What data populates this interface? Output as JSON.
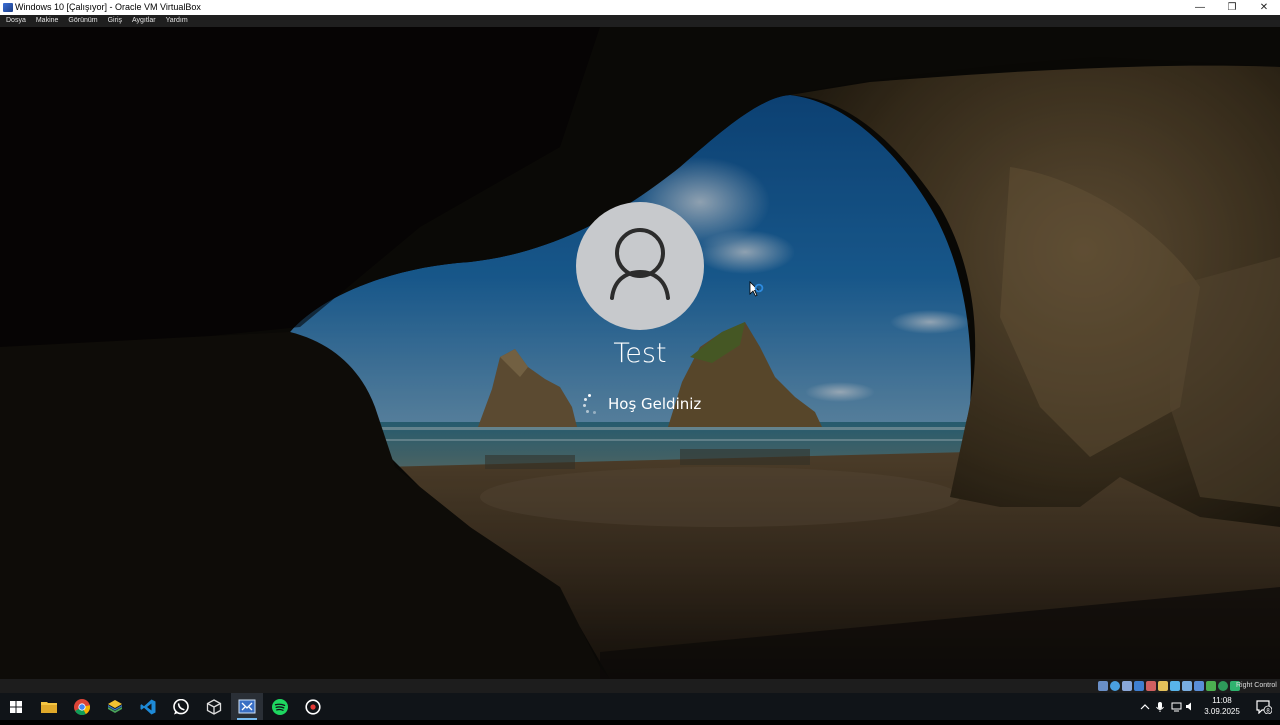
{
  "window": {
    "title": "Windows 10 [Çalışıyor] - Oracle VM VirtualBox",
    "controls": {
      "minimize": "—",
      "restore": "❐",
      "close": "✕"
    }
  },
  "menu": [
    "Dosya",
    "Makine",
    "Görünüm",
    "Giriş",
    "Aygıtlar",
    "Yardım"
  ],
  "lock_screen": {
    "user_name": "Test",
    "status_text": "Hoş Geldiniz",
    "avatar_icon": "user-silhouette-icon",
    "busy_indicator": "spinner-icon"
  },
  "vbox_status": {
    "host_key": "Right Control",
    "icons": [
      "hard-disk-icon",
      "optical-drive-icon",
      "audio-icon",
      "network-icon",
      "usb-icon",
      "shared-folders-icon",
      "display-icon",
      "video-capture-icon",
      "guest-additions-icon",
      "cpu-icon",
      "mouse-integration-icon",
      "keyboard-icon"
    ]
  },
  "taskbar": {
    "apps": [
      {
        "name": "start",
        "icon": "windows-start-icon",
        "active": false
      },
      {
        "name": "file-explorer",
        "icon": "folder-icon",
        "active": false
      },
      {
        "name": "chrome",
        "icon": "chrome-icon",
        "active": false
      },
      {
        "name": "layers-app",
        "icon": "layers-icon",
        "active": false
      },
      {
        "name": "vscode",
        "icon": "vscode-icon",
        "active": false
      },
      {
        "name": "whatsapp",
        "icon": "whatsapp-icon",
        "active": false
      },
      {
        "name": "virtualbox-manager",
        "icon": "cube-icon",
        "active": false
      },
      {
        "name": "virtualbox-vm",
        "icon": "virtualbox-vm-icon",
        "active": true
      },
      {
        "name": "spotify",
        "icon": "spotify-icon",
        "active": false
      },
      {
        "name": "recorder",
        "icon": "record-icon",
        "active": false
      }
    ],
    "clock_time": "11:08",
    "clock_date": "3.09.2025",
    "notification_count": "8",
    "tray_icons": [
      "chevron-up-icon",
      "microphone-icon",
      "network-icon",
      "volume-icon"
    ]
  }
}
